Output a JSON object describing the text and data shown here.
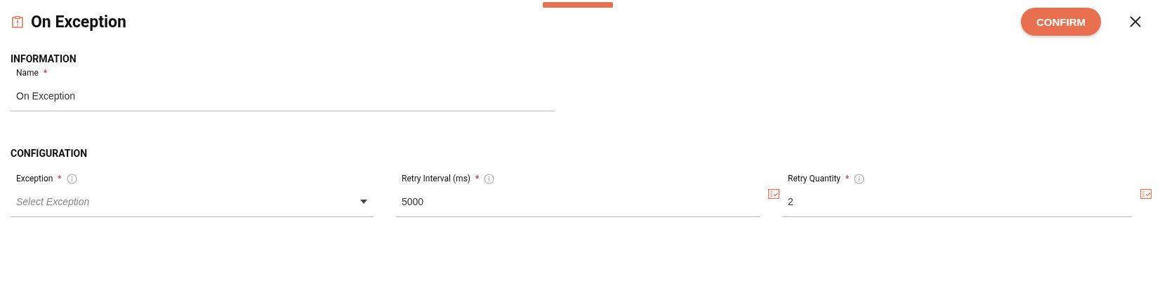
{
  "header": {
    "title": "On Exception",
    "confirm": "CONFIRM"
  },
  "sections": [
    {
      "title": "INFORMATION",
      "fields": [
        {
          "kind": "text",
          "label": "Name",
          "required_mark": "*",
          "value": "On Exception"
        }
      ]
    },
    {
      "title": "CONFIGURATION",
      "fields": [
        {
          "kind": "select",
          "label": "Exception",
          "required_mark": "*",
          "info": true,
          "placeholder": "Select Exception"
        },
        {
          "kind": "number",
          "label": "Retry Interval (ms)",
          "required_mark": "*",
          "info": true,
          "value": "5000"
        },
        {
          "kind": "number",
          "label": "Retry Quantity",
          "required_mark": "*",
          "info": true,
          "value": "2"
        }
      ]
    }
  ]
}
